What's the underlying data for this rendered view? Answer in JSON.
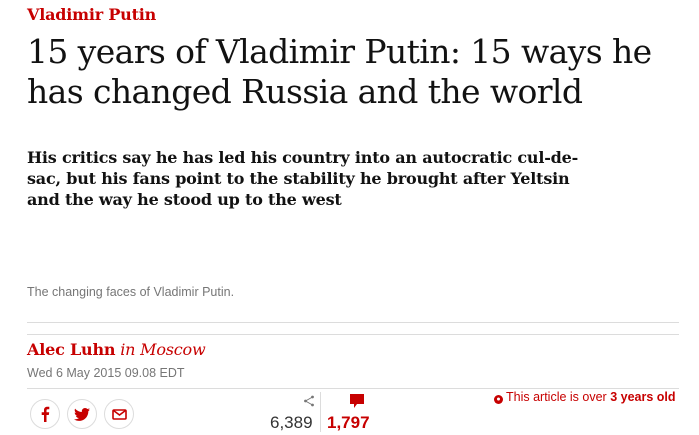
{
  "article": {
    "kicker": "Vladimir Putin",
    "headline": "15 years of Vladimir Putin: 15 ways he has changed Russia and the world",
    "standfirst": "His critics say he has led his country into an autocratic cul-de-sac, but his fans point to the stability he brought after Yeltsin and the way he stood up to the west",
    "caption": "The changing faces of Vladimir Putin.",
    "byline": {
      "author": "Alec Luhn",
      "location": "in Moscow"
    },
    "date": "Wed 6 May 2015 09.08 EDT"
  },
  "share": {
    "icons": [
      "facebook-icon",
      "twitter-icon",
      "email-icon"
    ],
    "count": "6,389"
  },
  "comments": {
    "count": "1,797"
  },
  "age_notice": {
    "prefix": "This article is over ",
    "age": "3 years old"
  },
  "colors": {
    "accent": "#c70000",
    "text": "#121212",
    "muted": "#767676",
    "rule": "#dcdcdc"
  }
}
